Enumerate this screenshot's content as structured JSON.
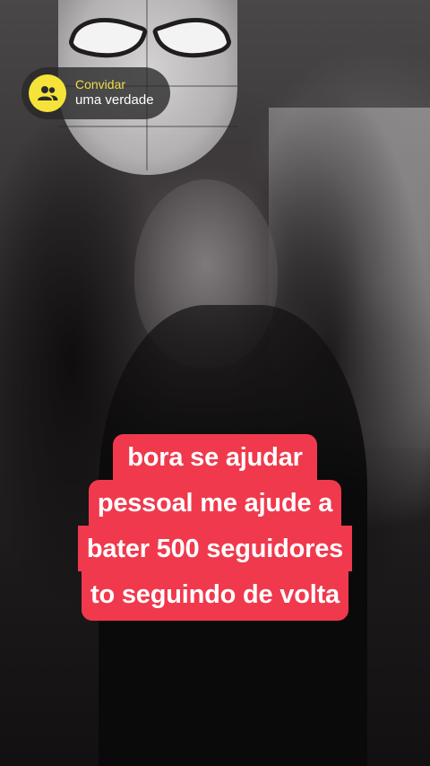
{
  "invite": {
    "title": "Convidar",
    "subtitle": "uma verdade",
    "icon": "group-icon",
    "icon_bg_color": "#f6e33a",
    "title_color": "#f1de48"
  },
  "caption": {
    "lines": [
      "bora se ajudar",
      "pessoal me ajude a",
      "bater 500 seguidores",
      "to seguindo de volta"
    ],
    "background_color": "#f0394d",
    "text_color": "#ffffff"
  }
}
